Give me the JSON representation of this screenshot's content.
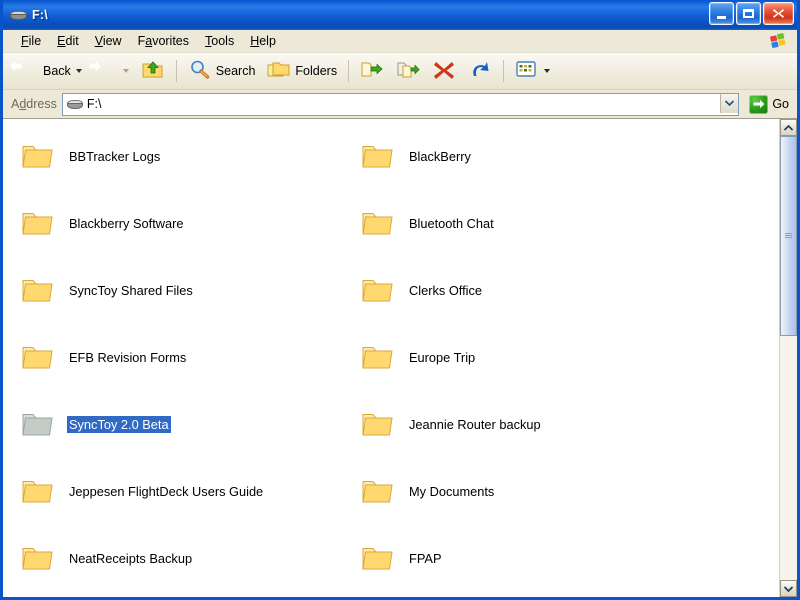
{
  "window": {
    "title": "F:\\",
    "title_icon": "drive-icon",
    "buttons": {
      "minimize": "minimize-button",
      "maximize": "maximize-button",
      "close": "close-button"
    }
  },
  "menubar": {
    "items": [
      {
        "label": "File",
        "accel": "F"
      },
      {
        "label": "Edit",
        "accel": "E"
      },
      {
        "label": "View",
        "accel": "V"
      },
      {
        "label": "Favorites",
        "accel": "a"
      },
      {
        "label": "Tools",
        "accel": "T"
      },
      {
        "label": "Help",
        "accel": "H"
      }
    ],
    "logo": "windows-flag-logo"
  },
  "toolbar": {
    "back_label": "Back",
    "back_icon": "back-arrow-icon",
    "forward_icon": "forward-arrow-icon",
    "up_icon": "up-folder-icon",
    "search_label": "Search",
    "search_icon": "search-magnifier-icon",
    "folders_label": "Folders",
    "folders_icon": "folders-icon",
    "move_to_icon": "move-to-folder-icon",
    "copy_to_icon": "copy-to-folder-icon",
    "delete_icon": "delete-x-icon",
    "undo_icon": "undo-arrow-icon",
    "views_icon": "views-icon"
  },
  "address": {
    "label": "Address",
    "label_accel": "d",
    "value": "F:\\",
    "icon": "drive-icon",
    "dropdown_icon": "chevron-down-icon",
    "go_label": "Go",
    "go_icon": "go-arrow-icon"
  },
  "files": {
    "items": [
      {
        "name": "BBTracker Logs",
        "selected": false,
        "dimmed": false
      },
      {
        "name": "BlackBerry",
        "selected": false,
        "dimmed": false
      },
      {
        "name": "Blackberry Software",
        "selected": false,
        "dimmed": false
      },
      {
        "name": "Bluetooth Chat",
        "selected": false,
        "dimmed": false
      },
      {
        "name": "SyncToy Shared Files",
        "selected": false,
        "dimmed": false
      },
      {
        "name": "Clerks Office",
        "selected": false,
        "dimmed": false
      },
      {
        "name": "EFB Revision Forms",
        "selected": false,
        "dimmed": false
      },
      {
        "name": "Europe Trip",
        "selected": false,
        "dimmed": false
      },
      {
        "name": "SyncToy 2.0 Beta",
        "selected": true,
        "dimmed": true
      },
      {
        "name": "Jeannie Router backup",
        "selected": false,
        "dimmed": false
      },
      {
        "name": "Jeppesen FlightDeck Users Guide",
        "selected": false,
        "dimmed": false
      },
      {
        "name": "My Documents",
        "selected": false,
        "dimmed": false
      },
      {
        "name": "NeatReceipts Backup",
        "selected": false,
        "dimmed": false
      },
      {
        "name": "FPAP",
        "selected": false,
        "dimmed": false
      }
    ]
  },
  "scrollbar": {
    "up_icon": "scroll-up-icon",
    "down_icon": "scroll-down-icon",
    "thumb_percent": 45
  },
  "colors": {
    "titlebar_blue": "#0f63da",
    "selection_blue": "#316ac5",
    "folder_yellow": "#ffd970",
    "close_red": "#cf3418",
    "go_green": "#2a9e18",
    "chrome": "#ece9d8"
  }
}
